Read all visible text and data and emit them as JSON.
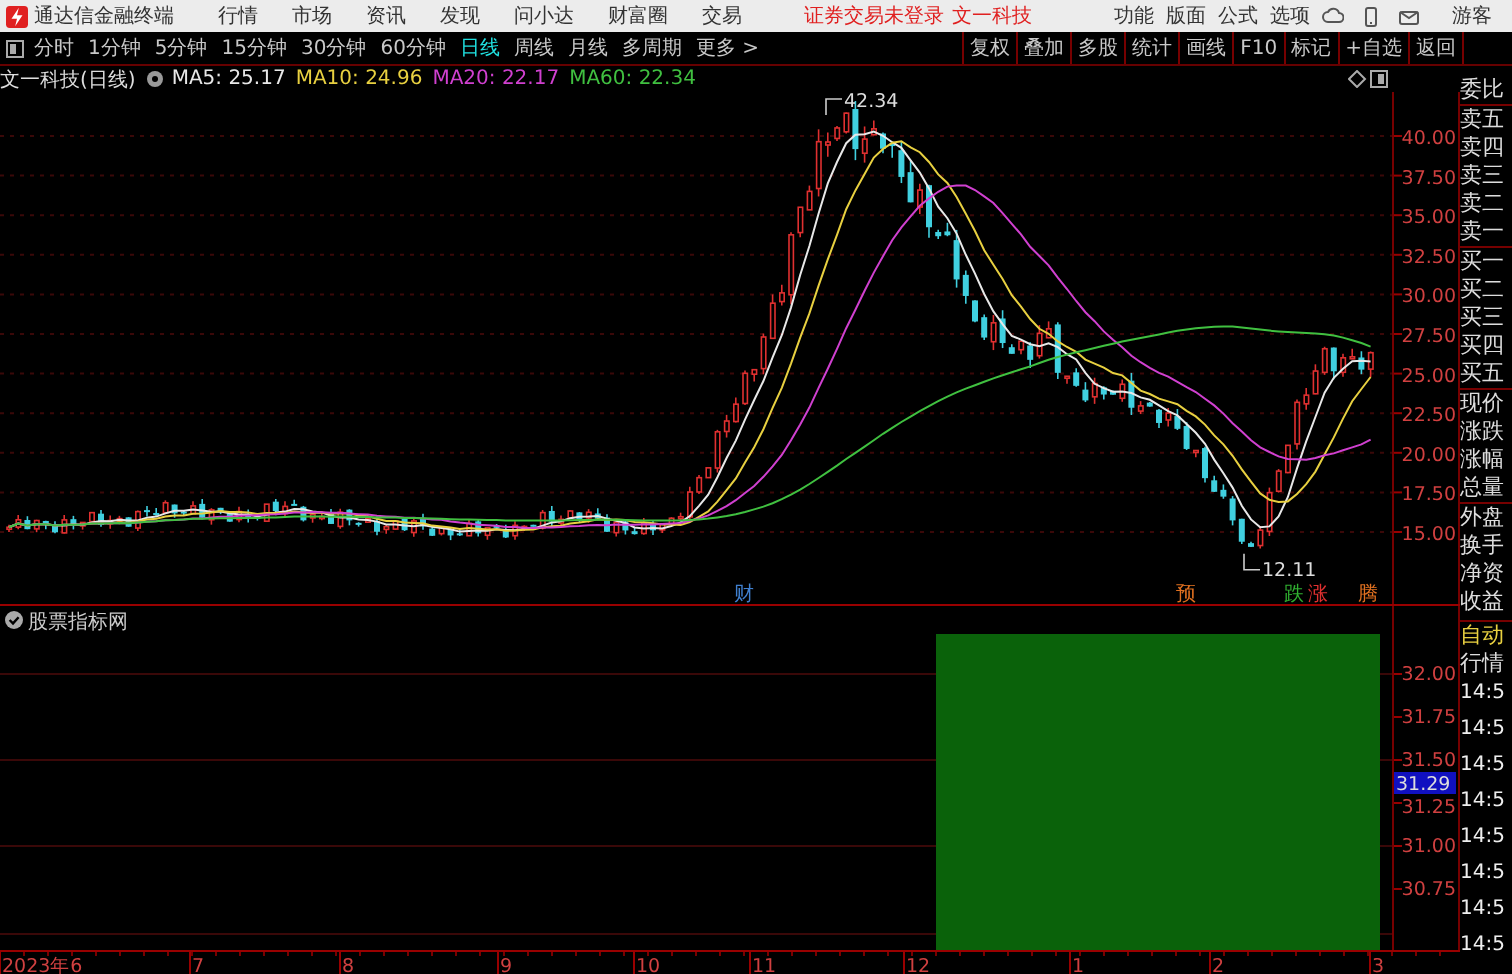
{
  "app": {
    "name": "通达信金融终端"
  },
  "menu": [
    "行情",
    "市场",
    "资讯",
    "发现",
    "问小达",
    "财富圈",
    "交易"
  ],
  "notice": {
    "login": "证券交易未登录",
    "stock": "文一科技"
  },
  "top_actions": [
    "功能",
    "版面",
    "公式",
    "选项"
  ],
  "user": "游客",
  "periods": [
    {
      "label": "分时",
      "selected": false
    },
    {
      "label": "1分钟",
      "selected": false
    },
    {
      "label": "5分钟",
      "selected": false
    },
    {
      "label": "15分钟",
      "selected": false
    },
    {
      "label": "30分钟",
      "selected": false
    },
    {
      "label": "60分钟",
      "selected": false
    },
    {
      "label": "日线",
      "selected": true
    },
    {
      "label": "周线",
      "selected": false
    },
    {
      "label": "月线",
      "selected": false
    },
    {
      "label": "多周期",
      "selected": false
    },
    {
      "label": "更多 >",
      "selected": false
    }
  ],
  "tools": [
    "复权",
    "叠加",
    "多股",
    "统计",
    "画线",
    "F10",
    "标记",
    "+自选",
    "返回"
  ],
  "chart_title": "文一科技(日线)",
  "ma": [
    {
      "label": "MA5: 25.17",
      "color": "#e8e8e8"
    },
    {
      "label": "MA10: 24.96",
      "color": "#e8d040"
    },
    {
      "label": "MA20: 22.17",
      "color": "#d040d0"
    },
    {
      "label": "MA60: 22.34",
      "color": "#40c040"
    }
  ],
  "price_axis": [
    "40.00",
    "37.50",
    "35.00",
    "32.50",
    "30.00",
    "27.50",
    "25.00",
    "22.50",
    "20.00",
    "17.50",
    "15.00"
  ],
  "annotations": {
    "high": "42.34",
    "low": "12.11"
  },
  "events": [
    {
      "label": "财",
      "color": "#4080d0"
    },
    {
      "label": "预",
      "color": "#e07020"
    },
    {
      "label": "跌",
      "color": "#30b030"
    },
    {
      "label": "涨",
      "color": "#e03030"
    },
    {
      "label": "腾",
      "color": "#e07020"
    }
  ],
  "indicator": {
    "name": "股票指标网"
  },
  "sub_axis": [
    "32.00",
    "31.75",
    "31.50",
    "31.25",
    "31.00",
    "30.75"
  ],
  "sub_current": "31.29",
  "date_axis": [
    "2023年6",
    "7",
    "8",
    "9",
    "10",
    "11",
    "12",
    "1",
    "2",
    "3"
  ],
  "quote_panel": {
    "labels": [
      "委比",
      "卖五",
      "卖四",
      "卖三",
      "卖二",
      "卖一",
      "买一",
      "买二",
      "买三",
      "买四",
      "买五",
      "现价",
      "涨跌",
      "涨幅",
      "总量",
      "外盘",
      "换手",
      "净资",
      "收益"
    ],
    "auto": "自动",
    "section": "行情",
    "times": [
      "14:5",
      "14:5",
      "14:5",
      "14:5",
      "14:5",
      "14:5",
      "14:5",
      "14:5"
    ]
  }
}
